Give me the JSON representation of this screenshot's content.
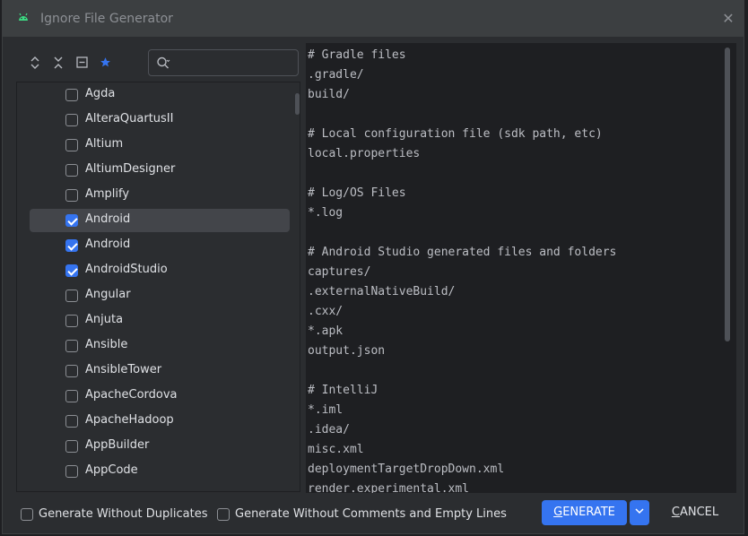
{
  "window": {
    "title": "Ignore File Generator",
    "close_icon": "close-icon"
  },
  "toolbar": {
    "buttons": [
      {
        "name": "expand-all",
        "icon": "expand-icon"
      },
      {
        "name": "collapse-all",
        "icon": "collapse-icon"
      },
      {
        "name": "toggle-view",
        "icon": "layout-icon"
      },
      {
        "name": "favorites",
        "icon": "star-icon"
      }
    ]
  },
  "search": {
    "value": "",
    "placeholder": "",
    "icon": "search-icon"
  },
  "templates": [
    {
      "label": "Agda",
      "checked": false,
      "selected": false
    },
    {
      "label": "AlteraQuartusII",
      "checked": false,
      "selected": false
    },
    {
      "label": "Altium",
      "checked": false,
      "selected": false
    },
    {
      "label": "AltiumDesigner",
      "checked": false,
      "selected": false
    },
    {
      "label": "Amplify",
      "checked": false,
      "selected": false
    },
    {
      "label": "Android",
      "checked": true,
      "selected": true
    },
    {
      "label": "Android",
      "checked": true,
      "selected": false
    },
    {
      "label": "AndroidStudio",
      "checked": true,
      "selected": false
    },
    {
      "label": "Angular",
      "checked": false,
      "selected": false
    },
    {
      "label": "Anjuta",
      "checked": false,
      "selected": false
    },
    {
      "label": "Ansible",
      "checked": false,
      "selected": false
    },
    {
      "label": "AnsibleTower",
      "checked": false,
      "selected": false
    },
    {
      "label": "ApacheCordova",
      "checked": false,
      "selected": false
    },
    {
      "label": "ApacheHadoop",
      "checked": false,
      "selected": false
    },
    {
      "label": "AppBuilder",
      "checked": false,
      "selected": false
    },
    {
      "label": "AppCode",
      "checked": false,
      "selected": false
    }
  ],
  "preview": {
    "lines": [
      "# Gradle files",
      ".gradle/",
      "build/",
      "",
      "# Local configuration file (sdk path, etc)",
      "local.properties",
      "",
      "# Log/OS Files",
      "*.log",
      "",
      "# Android Studio generated files and folders",
      "captures/",
      ".externalNativeBuild/",
      ".cxx/",
      "*.apk",
      "output.json",
      "",
      "# IntelliJ",
      "*.iml",
      ".idea/",
      "misc.xml",
      "deploymentTargetDropDown.xml",
      "render.experimental.xml"
    ]
  },
  "footer": {
    "without_duplicates": {
      "label": "Generate Without Duplicates",
      "checked": false
    },
    "without_comments": {
      "label": "Generate Without Comments and Empty Lines",
      "checked": false
    },
    "generate_label": "GENERATE",
    "generate_dropdown_icon": "chevron-down-icon",
    "cancel_label": "CANCEL"
  },
  "colors": {
    "accent": "#3574f0",
    "background": "#2b2d30",
    "editor_background": "#1e1f22",
    "android_icon": "#3ddc84"
  }
}
